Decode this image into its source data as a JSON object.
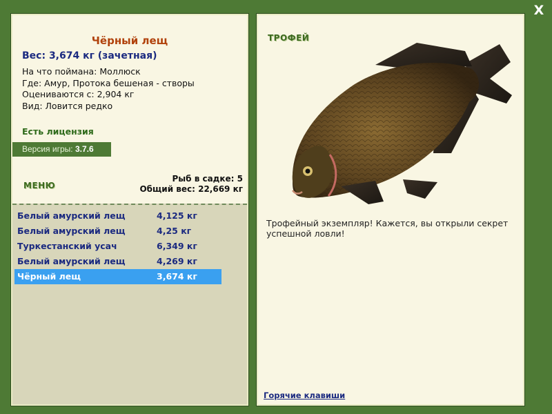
{
  "window": {
    "close_label": "X"
  },
  "fish": {
    "name": "Чёрный лещ",
    "weight_line": "Вес: 3,674 кг (зачетная)",
    "info": [
      "На что поймана: Моллюск",
      "Где: Амур, Протока бешеная - створы",
      "Оцениваются с: 2,904 кг",
      "Вид: Ловится редко"
    ]
  },
  "license_label": "Есть лицензия",
  "version": {
    "label": "Версия игры:",
    "value": "3.7.6"
  },
  "menu_label": "МЕНЮ",
  "net": {
    "count_label": "Рыб в садке: 5",
    "total_label": "Общий вес: 22,669 кг"
  },
  "catch_list": [
    {
      "name": "Белый амурский лещ",
      "weight": "4,125 кг",
      "selected": false
    },
    {
      "name": "Белый амурский лещ",
      "weight": "4,25 кг",
      "selected": false
    },
    {
      "name": "Туркестанский усач",
      "weight": "6,349 кг",
      "selected": false
    },
    {
      "name": "Белый амурский лещ",
      "weight": "4,269 кг",
      "selected": false
    },
    {
      "name": "Чёрный лещ",
      "weight": "3,674 кг",
      "selected": true
    }
  ],
  "trophy": {
    "tag": "ТРОФЕЙ",
    "image_icon": "bream-fish-image",
    "text": "Трофейный экземпляр! Кажется, вы открыли секрет успешной ловли!"
  },
  "hotkeys_label": "Горячие клавиши",
  "colors": {
    "background": "#4e7a35",
    "panel": "#f9f6e3",
    "title": "#b1420c",
    "link": "#1b2a80",
    "selected_row": "#3aa0f0"
  }
}
